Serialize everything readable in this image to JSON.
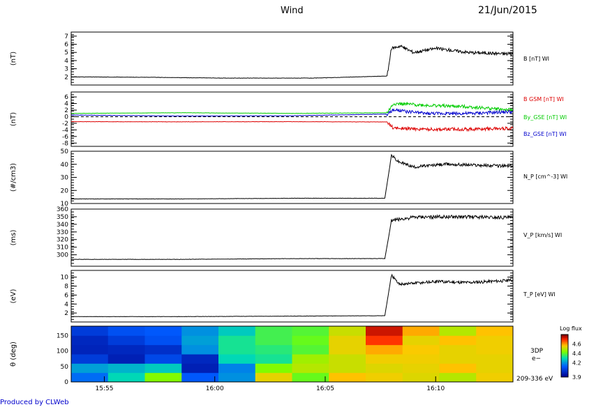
{
  "header": {
    "mission": "Wind",
    "date": "21/Jun/2015"
  },
  "footer": {
    "credit": "Produced by CLWeb"
  },
  "colors": {
    "black": "#000000",
    "red": "#dd0000",
    "green": "#00cc00",
    "blue": "#0000cc"
  },
  "chart_data": [
    {
      "type": "line",
      "panel": "B",
      "ylabel": "(nT)",
      "ylim": [
        1,
        7.5
      ],
      "yticks": [
        2,
        3,
        4,
        5,
        6,
        7
      ],
      "xlim_min": [
        0,
        20
      ],
      "series": [
        {
          "name": "B [nT] WI",
          "color": "#000000",
          "x": [
            0,
            3.5,
            7,
            11,
            14.3,
            14.5,
            14.9,
            15.5,
            16.5,
            18,
            20
          ],
          "y": [
            2.0,
            1.95,
            1.85,
            1.85,
            2.1,
            5.5,
            5.8,
            5.0,
            5.5,
            5.0,
            4.8
          ]
        }
      ]
    },
    {
      "type": "line",
      "panel": "B_GSM components",
      "ylabel": "(nT)",
      "ylim": [
        -9,
        7.5
      ],
      "yticks": [
        -8,
        -6,
        -4,
        -2,
        0,
        2,
        4,
        6
      ],
      "series": [
        {
          "name": "B GSM [nT] WI",
          "color": "#dd0000",
          "x": [
            0,
            5,
            10,
            14.3,
            14.6,
            16,
            18,
            20
          ],
          "y": [
            -1.5,
            -1.55,
            -1.5,
            -1.6,
            -3.5,
            -3.8,
            -3.8,
            -3.5
          ]
        },
        {
          "name": "By_GSE [nT] WI",
          "color": "#00cc00",
          "x": [
            0,
            5,
            10,
            14.3,
            14.6,
            16,
            18,
            20
          ],
          "y": [
            1.0,
            1.2,
            1.0,
            1.2,
            4.0,
            3.5,
            3.0,
            2.0
          ]
        },
        {
          "name": "Bz_GSE [nT] WI",
          "color": "#0000cc",
          "x": [
            0,
            5,
            10,
            14.3,
            14.6,
            16,
            18,
            20
          ],
          "y": [
            0.5,
            0.2,
            0.3,
            0.8,
            2.0,
            1.0,
            1.0,
            1.5
          ]
        }
      ]
    },
    {
      "type": "line",
      "panel": "N_P",
      "ylabel": "(#/cm3)",
      "ylim": [
        10,
        50
      ],
      "yticks": [
        10,
        20,
        30,
        40,
        50
      ],
      "series": [
        {
          "name": "N_P [cm^-3] WI",
          "color": "#000000",
          "x": [
            0,
            5,
            10,
            14.2,
            14.5,
            14.8,
            15.5,
            17,
            20
          ],
          "y": [
            13.5,
            13.5,
            14,
            14,
            47,
            42,
            38,
            40,
            38.5
          ]
        }
      ]
    },
    {
      "type": "line",
      "panel": "V_P",
      "ylabel": "(ms)",
      "ylim": [
        285,
        360
      ],
      "yticks": [
        300,
        310,
        320,
        330,
        340,
        350,
        360
      ],
      "series": [
        {
          "name": "V_P [km/s] WI",
          "color": "#000000",
          "x": [
            0,
            5,
            10,
            14.2,
            14.5,
            15.5,
            17,
            20
          ],
          "y": [
            294,
            294,
            295,
            295,
            345,
            349,
            350,
            349
          ]
        }
      ]
    },
    {
      "type": "line",
      "panel": "T_P",
      "ylabel": "(eV)",
      "ylim": [
        0,
        11.5
      ],
      "yticks": [
        2,
        4,
        6,
        8,
        10
      ],
      "series": [
        {
          "name": "T_P [eV] WI",
          "color": "#000000",
          "x": [
            0,
            5,
            10,
            14.2,
            14.5,
            14.8,
            15.2,
            16.5,
            18,
            20
          ],
          "y": [
            1.2,
            1.2,
            1.3,
            1.4,
            10.5,
            8.5,
            8.5,
            9.0,
            8.8,
            9.3
          ]
        }
      ]
    },
    {
      "type": "heatmap",
      "panel": "3DP",
      "ylabel": "θ (deg)",
      "ylim": [
        0,
        180
      ],
      "yticks": [
        0,
        50,
        100,
        150
      ],
      "xticks": [
        "15:55",
        "16:00",
        "16:05",
        "16:10"
      ],
      "legend_title": "Log flux",
      "colorbar_ticks": [
        3.9,
        4.2,
        4.4,
        4.6
      ],
      "label_top": "3DP",
      "label_mid": "e−",
      "label_bottom": "209-336 eV",
      "time_bins": 12,
      "theta_bins": 6,
      "values": [
        [
          4.15,
          4.3,
          4.45,
          4.12,
          4.2,
          4.55,
          4.42,
          4.58,
          4.56,
          4.54,
          4.5,
          4.56
        ],
        [
          4.22,
          4.25,
          4.28,
          3.98,
          4.18,
          4.45,
          4.5,
          4.52,
          4.54,
          4.55,
          4.58,
          4.55
        ],
        [
          4.05,
          3.98,
          4.08,
          4.0,
          4.3,
          4.33,
          4.48,
          4.52,
          4.56,
          4.56,
          4.55,
          4.55
        ],
        [
          3.99,
          4.0,
          4.02,
          4.2,
          4.33,
          4.35,
          4.4,
          4.55,
          4.6,
          4.57,
          4.55,
          4.56
        ],
        [
          4.0,
          4.05,
          4.1,
          4.22,
          4.33,
          4.38,
          4.42,
          4.55,
          4.7,
          4.55,
          4.58,
          4.56
        ],
        [
          4.05,
          4.1,
          4.12,
          4.2,
          4.28,
          4.38,
          4.4,
          4.52,
          4.75,
          4.6,
          4.5,
          4.58
        ]
      ]
    }
  ]
}
